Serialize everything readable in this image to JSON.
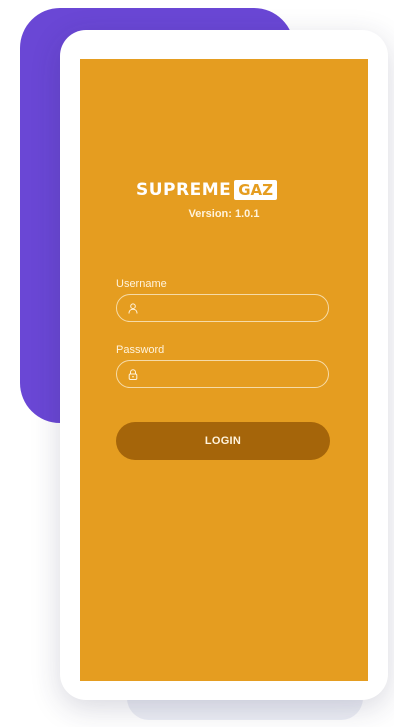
{
  "brand": {
    "name_main": "SUPREME",
    "name_accent": "GAZ",
    "version": "Version: 1.0.1"
  },
  "form": {
    "username_label": "Username",
    "username_value": "",
    "username_icon": "user-icon",
    "password_label": "Password",
    "password_value": "",
    "password_icon": "lock-icon",
    "login_label": "LOGIN"
  },
  "colors": {
    "screen_background": "#e59d20",
    "login_button": "#a5650a",
    "decor_card": "#6a47d5"
  }
}
